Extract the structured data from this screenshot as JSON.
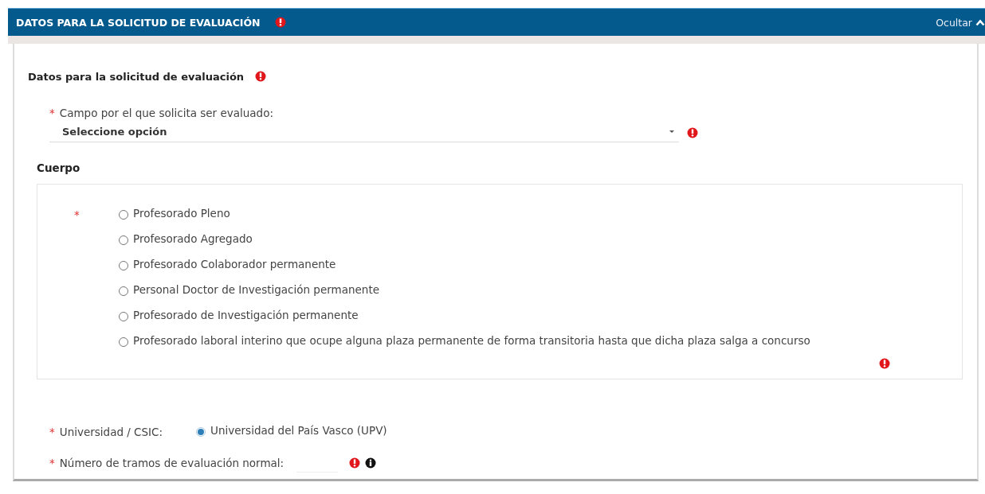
{
  "section": {
    "title": "DATOS PARA LA SOLICITUD DE EVALUACIÓN",
    "error": true,
    "toggle": "Ocultar",
    "expanded": true
  },
  "panel": {
    "title": "Datos para la solicitud de evaluación",
    "error": true
  },
  "campo": {
    "required_mark": "*",
    "label": "Campo por el que solicita ser evaluado:",
    "value": "Seleccione opción",
    "error": true
  },
  "cuerpo": {
    "heading": "Cuerpo",
    "required_mark": "*",
    "error": true,
    "options": [
      {
        "label": "Profesorado Pleno",
        "selected": false
      },
      {
        "label": "Profesorado Agregado",
        "selected": false
      },
      {
        "label": "Profesorado Colaborador permanente",
        "selected": false
      },
      {
        "label": "Personal Doctor de Investigación permanente",
        "selected": false
      },
      {
        "label": "Profesorado de Investigación permanente",
        "selected": false
      },
      {
        "label": "Profesorado laboral interino que ocupe alguna plaza permanente de forma transitoria hasta que dicha plaza salga a concurso",
        "selected": false
      }
    ]
  },
  "universidad": {
    "required_mark": "*",
    "label": "Universidad / CSIC:",
    "options": [
      {
        "label": "Universidad del País Vasco (UPV)",
        "selected": true
      }
    ]
  },
  "tramos": {
    "required_mark": "*",
    "label": "Número de tramos de evaluación normal:",
    "error": true,
    "info": true
  }
}
